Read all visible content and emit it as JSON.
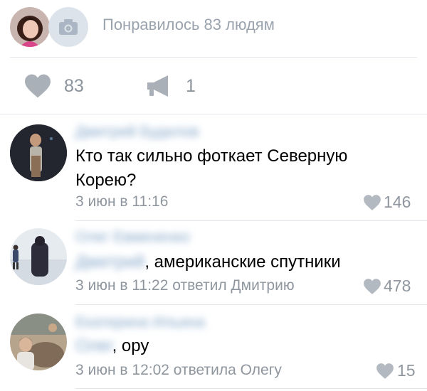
{
  "likes_summary": {
    "text": "Понравилось 83 людям"
  },
  "actions": {
    "like_count": "83",
    "repost_count": "1"
  },
  "comments": [
    {
      "author": "Дмитрий Будилов",
      "text": "Кто так сильно фоткает Северную Корею?",
      "meta": "3 июн в 11:16",
      "likes": "146"
    },
    {
      "author": "Олег Евмененко",
      "reply_to": "Дмитрий",
      "text": ", американские спутники",
      "meta": "3 июн в 11:22 ответил Дмитрию",
      "likes": "478"
    },
    {
      "author": "Екатерина Ильина",
      "reply_to": "Олег",
      "text": ", ору",
      "meta": "3 июн в 12:02 ответила Олегу",
      "likes": "15"
    }
  ],
  "colors": {
    "link_blue": "#7fa3c7",
    "gray_text": "#8f969e",
    "icon_gray": "#a9b0b8"
  }
}
